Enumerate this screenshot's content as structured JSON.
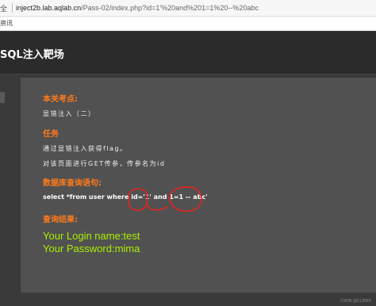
{
  "browser": {
    "secure_label": "全",
    "url_host": "inject2b.lab.aqlab.cn",
    "url_path": "/Pass-02/index.php?id=1'%20and%201=1%20--%20abc"
  },
  "bookmarks": {
    "item": "资讯"
  },
  "header": {
    "title": "SQL注入靶场"
  },
  "panel": {
    "level_title": "本关考点:",
    "level_text": "显错注入（二）",
    "task_title": "任务",
    "task_line1": "通过显错注入获得flag。",
    "task_line2": "对该页面进行GET传参，传参名为id",
    "query_title": "数据库查询语句:",
    "query_text": "select *from user where id='1' and 1=1 -- abc'",
    "result_title": "查询结果:",
    "result_login": "Your Login name:test",
    "result_password": "Your Password:mima"
  },
  "colors": {
    "accent_orange": "#ff7a1a",
    "result_green": "#a8f000",
    "annotation_red": "#e8231c"
  },
  "watermark": "CSDN @CLIENX"
}
